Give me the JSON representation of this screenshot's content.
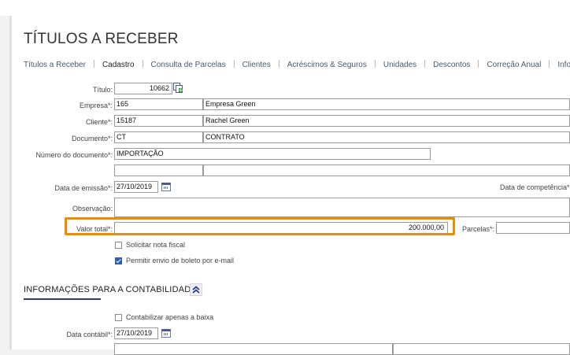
{
  "page": {
    "title": "TÍTULOS A RECEBER"
  },
  "tabs": [
    {
      "label": "Títulos a Receber"
    },
    {
      "label": "Cadastro"
    },
    {
      "label": "Consulta de Parcelas"
    },
    {
      "label": "Clientes"
    },
    {
      "label": "Acréscimos & Seguros"
    },
    {
      "label": "Unidades"
    },
    {
      "label": "Descontos"
    },
    {
      "label": "Correção Anual"
    },
    {
      "label": "Informa"
    }
  ],
  "form": {
    "titulo": {
      "label": "Título:",
      "value": "10662"
    },
    "empresa": {
      "label": "Empresa*:",
      "code": "165",
      "name": "Empresa Green"
    },
    "cliente": {
      "label": "Cliente*:",
      "code": "15187",
      "name": "Rachel Green"
    },
    "documento": {
      "label": "Documento*:",
      "code": "CT",
      "name": "CONTRATO"
    },
    "numero_documento": {
      "label": "Número do documento*:",
      "value": "IMPORTAÇÃO"
    },
    "data_emissao": {
      "label": "Data de emissão*:",
      "value": "27/10/2019"
    },
    "data_competencia": {
      "label": "Data de competência*"
    },
    "observacao": {
      "label": "Observação:",
      "value": ""
    },
    "valor_total": {
      "label": "Valor total*:",
      "value": "200.000,00"
    },
    "parcelas": {
      "label": "Parcelas*:",
      "value": ""
    },
    "solicitar_nota": {
      "label": "Solicitar nota fiscal",
      "checked": false
    },
    "permitir_boleto": {
      "label": "Permitir envio de boleto por e-mail",
      "checked": true
    }
  },
  "contabilidade": {
    "title": "INFORMAÇÕES PARA A CONTABILIDADE",
    "contabilizar_baixa": {
      "label": "Contabilizar apenas a baixa",
      "checked": false
    },
    "data_contabil": {
      "label": "Data contábil*:",
      "value": "27/10/2019"
    }
  },
  "colors": {
    "highlight": "#f08a00",
    "accent": "#2a3a7a",
    "checkbox": "#2f5fb5"
  }
}
